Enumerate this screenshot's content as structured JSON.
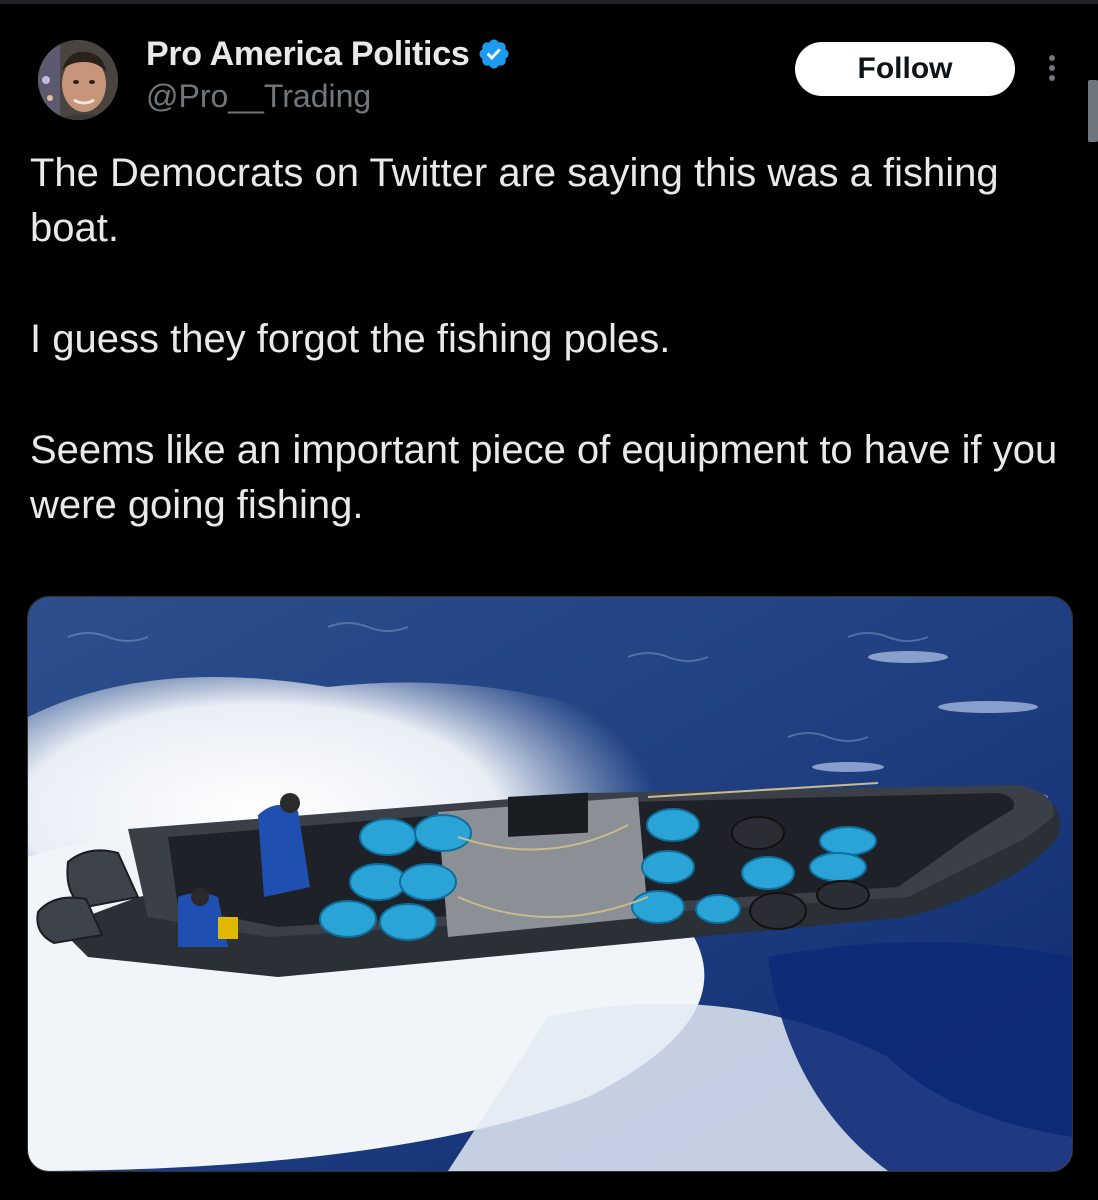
{
  "author": {
    "display_name": "Pro America Politics",
    "handle": "@Pro__Trading",
    "verified": true,
    "verified_color": "#1d9bf0"
  },
  "actions": {
    "follow_label": "Follow",
    "more_icon": "more-vertical-icon"
  },
  "tweet": {
    "paragraphs": [
      "The Democrats on Twitter are saying this was a fishing boat.",
      "I guess they forgot the fishing poles.",
      "Seems like an important piece of equipment to have if you were going fishing."
    ]
  },
  "media": {
    "type": "photo"
  },
  "colors": {
    "background": "#000000",
    "text_primary": "#e7e9ea",
    "text_secondary": "#71767b",
    "button_bg": "#ffffff",
    "button_text": "#0f1419"
  }
}
